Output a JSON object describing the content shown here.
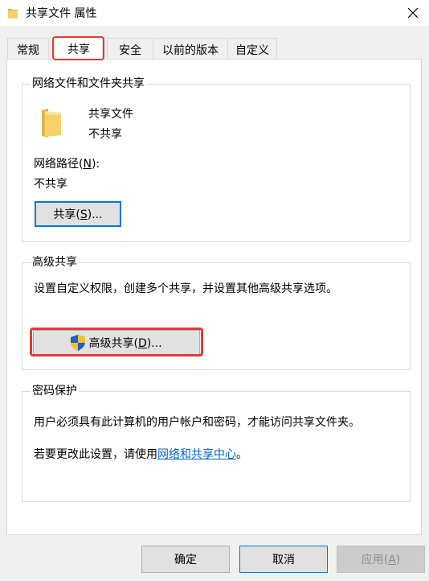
{
  "window": {
    "title": "共享文件 属性",
    "close_glyph": "✕"
  },
  "tabs": [
    {
      "label": "常规"
    },
    {
      "label": "共享"
    },
    {
      "label": "安全"
    },
    {
      "label": "以前的版本"
    },
    {
      "label": "自定义"
    }
  ],
  "network_sharing": {
    "group_title": "网络文件和文件夹共享",
    "folder_name": "共享文件",
    "share_status": "不共享",
    "path_label_pre": "网络路径(",
    "path_label_key": "N",
    "path_label_post": "):",
    "path_value": "不共享",
    "share_button_pre": "共享(",
    "share_button_key": "S",
    "share_button_post": ")..."
  },
  "advanced_sharing": {
    "group_title": "高级共享",
    "description": "设置自定义权限，创建多个共享，并设置其他高级共享选项。",
    "button_pre": "高级共享(",
    "button_key": "D",
    "button_post": ")..."
  },
  "password_protection": {
    "group_title": "密码保护",
    "description": "用户必须具有此计算机的用户帐户和密码，才能访问共享文件夹。",
    "change_pre": "若要更改此设置，请使用",
    "change_link": "网络和共享中心",
    "change_post": "。"
  },
  "footer": {
    "ok": "确定",
    "cancel": "取消",
    "apply_pre": "应用(",
    "apply_key": "A",
    "apply_post": ")"
  },
  "icons": {
    "folder": "folder-icon",
    "shield": "uac-shield-icon",
    "close": "close-icon"
  },
  "colors": {
    "highlight_red": "#e53935",
    "focus_blue": "#0078d7",
    "link_blue": "#0066cc",
    "folder_yellow": "#f6d06b"
  }
}
